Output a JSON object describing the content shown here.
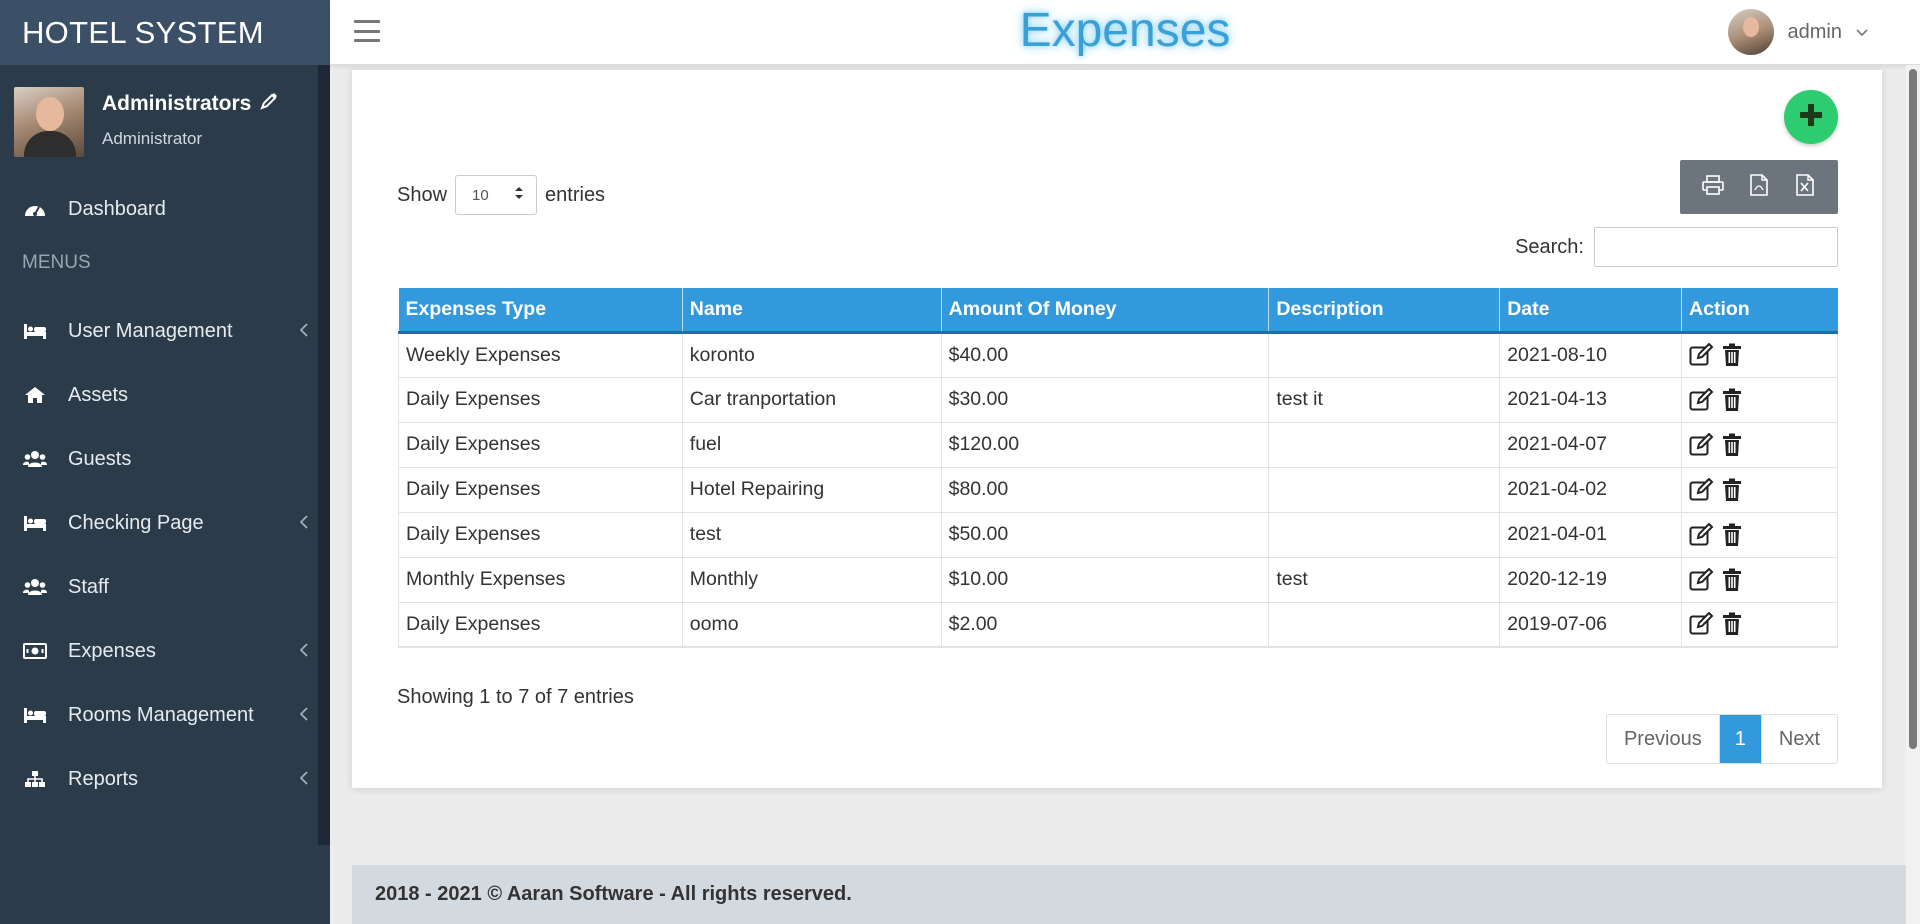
{
  "brand": "HOTEL SYSTEM",
  "profile": {
    "name": "Administrators",
    "role": "Administrator"
  },
  "sidebar": {
    "dashboard": "Dashboard",
    "menus_label": "MENUS",
    "items": [
      {
        "label": "User Management",
        "icon": "bed-icon",
        "chevron": true
      },
      {
        "label": "Assets",
        "icon": "home-icon",
        "chevron": false
      },
      {
        "label": "Guests",
        "icon": "users-icon",
        "chevron": false
      },
      {
        "label": "Checking Page",
        "icon": "bed-icon",
        "chevron": true
      },
      {
        "label": "Staff",
        "icon": "users-icon",
        "chevron": false
      },
      {
        "label": "Expenses",
        "icon": "money-icon",
        "chevron": true
      },
      {
        "label": "Rooms Management",
        "icon": "bed-icon",
        "chevron": true
      },
      {
        "label": "Reports",
        "icon": "sitemap-icon",
        "chevron": true
      }
    ]
  },
  "topbar": {
    "title": "Expenses",
    "user": "admin"
  },
  "controls": {
    "show": "Show",
    "page_size": "10",
    "entries": "entries",
    "search_label": "Search:",
    "search_value": ""
  },
  "table": {
    "headers": [
      "Expenses Type",
      "Name",
      "Amount Of Money",
      "Description",
      "Date",
      "Action"
    ],
    "rows": [
      [
        "Weekly Expenses",
        "koronto",
        "$40.00",
        "",
        "2021-08-10"
      ],
      [
        "Daily Expenses",
        "Car tranportation",
        "$30.00",
        "test it",
        "2021-04-13"
      ],
      [
        "Daily Expenses",
        "fuel",
        "$120.00",
        "",
        "2021-04-07"
      ],
      [
        "Daily Expenses",
        "Hotel Repairing",
        "$80.00",
        "",
        "2021-04-02"
      ],
      [
        "Daily Expenses",
        "test",
        "$50.00",
        "",
        "2021-04-01"
      ],
      [
        "Monthly Expenses",
        "Monthly",
        "$10.00",
        "test",
        "2020-12-19"
      ],
      [
        "Daily Expenses",
        "oomo",
        "$2.00",
        "",
        "2019-07-06"
      ]
    ]
  },
  "info": "Showing 1 to 7 of 7 entries",
  "pagination": {
    "previous": "Previous",
    "current": "1",
    "next": "Next"
  },
  "footer": "2018 - 2021 © Aaran Software - All rights reserved.",
  "colors": {
    "sidebar": "#2c3b49",
    "brand": "#3b5066",
    "accent": "#3399dd",
    "add": "#2ecc71",
    "title": "#3aa0d8"
  }
}
